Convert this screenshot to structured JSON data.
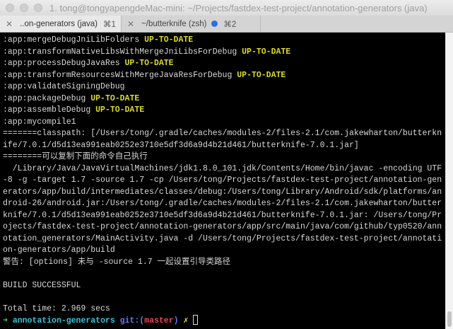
{
  "window": {
    "title": "1. tong@tongyapengdeMac-mini: ~/Projects/fastdex-test-project/annotation-generators (java)"
  },
  "tabs": [
    {
      "label": "..on-generators (java)",
      "shortcut": "⌘1",
      "close": "✕",
      "active": true
    },
    {
      "label": "~/butterknife (zsh)",
      "shortcut": "⌘2",
      "close": "✕",
      "active": false,
      "activity_dot": true
    }
  ],
  "colors": {
    "up_to_date": "#d9d92a",
    "prompt_arrow": "#3fdc5a",
    "dir": "#34c6d9",
    "git": "#5e7cf2",
    "branch": "#e8485a"
  },
  "terminal": {
    "lines": [
      [
        {
          "t": ":app:mergeDebugJniLibFolders "
        },
        {
          "t": "UP-TO-DATE",
          "c": "c-yellow"
        }
      ],
      [
        {
          "t": ":app:transformNativeLibsWithMergeJniLibsForDebug "
        },
        {
          "t": "UP-TO-DATE",
          "c": "c-yellow"
        }
      ],
      [
        {
          "t": ":app:processDebugJavaRes "
        },
        {
          "t": "UP-TO-DATE",
          "c": "c-yellow"
        }
      ],
      [
        {
          "t": ":app:transformResourcesWithMergeJavaResForDebug "
        },
        {
          "t": "UP-TO-DATE",
          "c": "c-yellow"
        }
      ],
      [
        {
          "t": ":app:validateSigningDebug"
        }
      ],
      [
        {
          "t": ":app:packageDebug "
        },
        {
          "t": "UP-TO-DATE",
          "c": "c-yellow"
        }
      ],
      [
        {
          "t": ":app:assembleDebug "
        },
        {
          "t": "UP-TO-DATE",
          "c": "c-yellow"
        }
      ],
      [
        {
          "t": ":app:mycompile1"
        }
      ],
      [
        {
          "t": "=======classpath: [/Users/tong/.gradle/caches/modules-2/files-2.1/com.jakewharton/butterkn"
        }
      ],
      [
        {
          "t": "ife/7.0.1/d5d13ea991eab0252e3710e5df3d6a9d4b21d461/butterknife-7.0.1.jar]"
        }
      ],
      [
        {
          "t": "========可以复制下面的命令自己执行"
        }
      ],
      [
        {
          "t": "  /Library/Java/JavaVirtualMachines/jdk1.8.0_101.jdk/Contents/Home/bin/javac -encoding UTF"
        }
      ],
      [
        {
          "t": "-8 -g -target 1.7 -source 1.7 -cp /Users/tong/Projects/fastdex-test-project/annotation-gen"
        }
      ],
      [
        {
          "t": "erators/app/build/intermediates/classes/debug:/Users/tong/Library/Android/sdk/platforms/an"
        }
      ],
      [
        {
          "t": "droid-26/android.jar:/Users/tong/.gradle/caches/modules-2/files-2.1/com.jakewharton/butter"
        }
      ],
      [
        {
          "t": "knife/7.0.1/d5d13ea991eab0252e3710e5df3d6a9d4b21d461/butterknife-7.0.1.jar: /Users/tong/Pr"
        }
      ],
      [
        {
          "t": "ojects/fastdex-test-project/annotation-generators/app/src/main/java/com/github/typ0520/ann"
        }
      ],
      [
        {
          "t": "otation_generators/MainActivity.java -d /Users/tong/Projects/fastdex-test-project/annotati"
        }
      ],
      [
        {
          "t": "on-generators/app/build"
        }
      ],
      [
        {
          "t": "警告: [options] 未与 -source 1.7 一起设置引导类路径"
        }
      ],
      [],
      [
        {
          "t": "BUILD SUCCESSFUL"
        }
      ],
      [],
      [
        {
          "t": "Total time: 2.969 secs"
        }
      ]
    ],
    "prompt": {
      "arrow": "➜",
      "dir": "annotation-generators",
      "git_prefix": "git:(",
      "branch": "master",
      "git_suffix": ")",
      "dirty": "✗"
    }
  }
}
